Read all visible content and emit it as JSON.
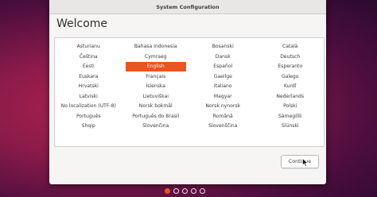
{
  "window": {
    "title": "System Configuration"
  },
  "page": {
    "heading": "Welcome"
  },
  "languages": [
    [
      "Asturianu",
      "Bahasa Indonesia",
      "Bosanski",
      "Català"
    ],
    [
      "Čeština",
      "Cymraeg",
      "Dansk",
      "Deutsch"
    ],
    [
      "Eesti",
      "English",
      "Español",
      "Esperanto"
    ],
    [
      "Euskara",
      "Français",
      "Gaeilge",
      "Galego"
    ],
    [
      "Hrvatski",
      "Íslenska",
      "Italiano",
      "Kurdî"
    ],
    [
      "Latviski",
      "Lietuviškai",
      "Magyar",
      "Nederlands"
    ],
    [
      "No localization (UTF-8)",
      "Norsk bokmål",
      "Norsk nynorsk",
      "Polski"
    ],
    [
      "Português",
      "Português do Brasil",
      "Română",
      "Sámegillii"
    ],
    [
      "Shqip",
      "Slovenčina",
      "Slovenščina",
      "Slünski"
    ]
  ],
  "selected_language": "English",
  "buttons": {
    "continue_label": "Continue"
  },
  "pagination": {
    "total": 5,
    "current": 1
  },
  "colors": {
    "accent": "#e95420",
    "window_bg": "#f6f5f4",
    "titlebar_bg": "#e8e7e6"
  },
  "icons": {
    "cursor": "mouse-pointer-icon"
  }
}
